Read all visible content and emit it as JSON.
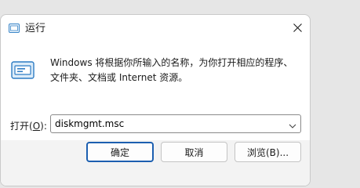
{
  "window": {
    "title": "运行",
    "title_icon": "run-app-icon",
    "close_icon": "close-icon"
  },
  "body": {
    "app_icon": "run-dialog-icon",
    "description_line1": "Windows 将根据你所输入的名称，为你打开相应的程序、",
    "description_line2": "文件夹、文档或 Internet 资源。"
  },
  "open": {
    "label_prefix": "打开(",
    "label_accel": "O",
    "label_suffix": "):",
    "value": "diskmgmt.msc"
  },
  "buttons": {
    "ok_label": "确定",
    "cancel_label": "取消",
    "browse_label": "浏览(B)..."
  },
  "colors": {
    "accent": "#1c5fb0",
    "footer_bg": "#f3f3f3"
  }
}
